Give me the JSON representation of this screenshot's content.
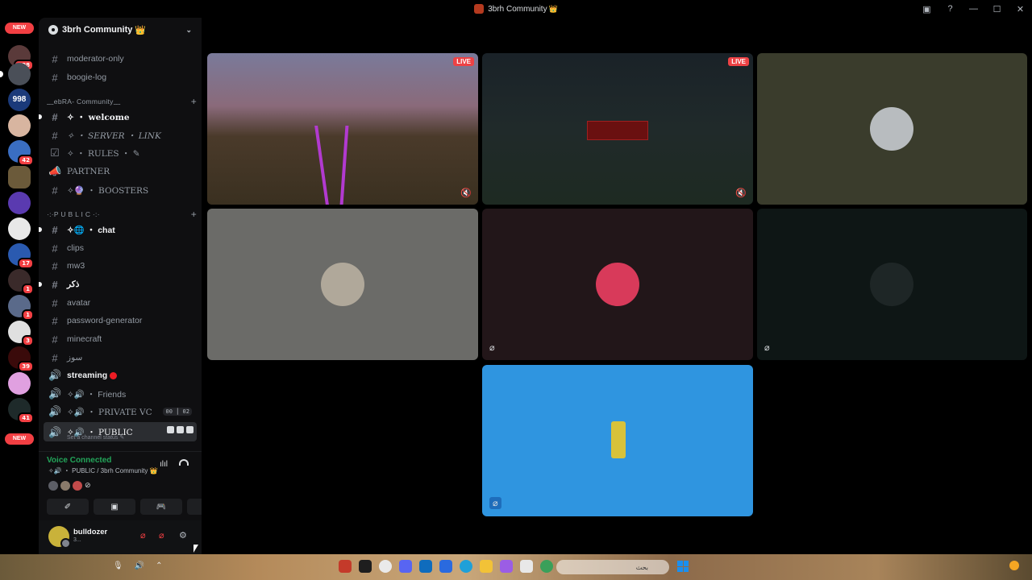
{
  "window": {
    "title": "3brh Community",
    "title_crown": "👑",
    "controls": [
      "inbox-icon",
      "help-icon",
      "minimize-icon",
      "maximize-icon",
      "close-icon"
    ]
  },
  "servers": {
    "new_label": "NEW",
    "badges": [
      "398",
      "998",
      "42",
      "17",
      "1",
      "1",
      "3",
      "39",
      "41"
    ],
    "bottom_new_label": "NEW"
  },
  "guild": {
    "name": "3brh Community",
    "crown": "👑",
    "chevron": "⌄"
  },
  "channels": {
    "top": [
      {
        "icon": "#",
        "label": "moderator-only"
      },
      {
        "icon": "#",
        "label": "boogie-log"
      }
    ],
    "category1": {
      "label": "﹏ebRA- Community﹏",
      "plus": "+"
    },
    "cat1_items": [
      {
        "icon": "#",
        "label": "✧ ・ welcome"
      },
      {
        "icon": "#",
        "label": "✧ ・ SERVER ・ LINK"
      },
      {
        "icon": "☑",
        "label": "✧ ・ RULES ・ ✎"
      },
      {
        "icon": "📣",
        "label": "PARTNER"
      },
      {
        "icon": "#",
        "label": "✧🔮 ・ BOOSTERS"
      }
    ],
    "category2": {
      "label": "·:·P U B L I C ·:·",
      "plus": "+"
    },
    "cat2_items": [
      {
        "icon": "#",
        "label": "✧🌐 ・ chat"
      },
      {
        "icon": "#",
        "label": "clips"
      },
      {
        "icon": "#",
        "label": "mw3"
      },
      {
        "icon": "#",
        "label": "ذكر"
      },
      {
        "icon": "#",
        "label": "avatar"
      },
      {
        "icon": "#",
        "label": "password-generator"
      },
      {
        "icon": "#",
        "label": "minecraft"
      },
      {
        "icon": "#",
        "label": "سوز"
      }
    ],
    "voice": [
      {
        "icon": "🔊",
        "label": "streaming"
      },
      {
        "icon": "🔊",
        "label": "✧🔊 ・ Friends"
      },
      {
        "icon": "🔊",
        "label": "✧🔊 ・ PRIVATE VC",
        "limit": "00 ⎮ 02"
      },
      {
        "icon": "🔊",
        "label": "✧🔊 ・ PUBLIC",
        "status": "Set a channel status ✎"
      }
    ]
  },
  "voice_panel": {
    "title": "Voice Connected",
    "subtitle": "✧🔊 ・ PUBLIC / 3brh Community 👑",
    "actions": [
      "✐",
      "▣",
      "🎮",
      "✦"
    ]
  },
  "user": {
    "name": "bulldozer",
    "status": "3..."
  },
  "stage": {
    "live_label": "LIVE"
  },
  "taskbar": {
    "search_placeholder": "بحث"
  }
}
